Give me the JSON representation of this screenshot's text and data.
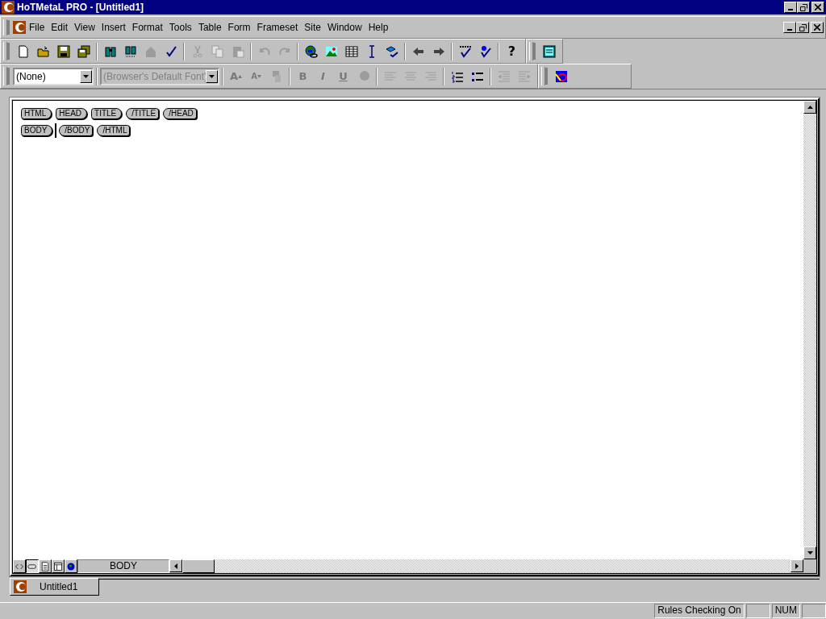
{
  "window": {
    "title": "HoTMetaL PRO - [Untitled1]"
  },
  "menu": [
    "File",
    "Edit",
    "View",
    "Insert",
    "Format",
    "Tools",
    "Table",
    "Form",
    "Frameset",
    "Site",
    "Window",
    "Help"
  ],
  "toolbar": [
    {
      "kind": "new",
      "disabled": false
    },
    {
      "kind": "open",
      "disabled": false
    },
    {
      "kind": "save",
      "disabled": false
    },
    {
      "kind": "saveall",
      "disabled": false
    },
    {
      "kind": "sep"
    },
    {
      "kind": "find",
      "disabled": false
    },
    {
      "kind": "findnext",
      "disabled": false
    },
    {
      "kind": "replace",
      "disabled": true
    },
    {
      "kind": "spell",
      "disabled": false
    },
    {
      "kind": "sep"
    },
    {
      "kind": "cut",
      "disabled": true
    },
    {
      "kind": "copy",
      "disabled": true
    },
    {
      "kind": "paste",
      "disabled": true
    },
    {
      "kind": "sep"
    },
    {
      "kind": "undo",
      "disabled": true
    },
    {
      "kind": "redo",
      "disabled": true
    },
    {
      "kind": "sep"
    },
    {
      "kind": "link",
      "disabled": false
    },
    {
      "kind": "image",
      "disabled": false
    },
    {
      "kind": "table",
      "disabled": false
    },
    {
      "kind": "cursor",
      "disabled": false
    },
    {
      "kind": "highlight",
      "disabled": false
    },
    {
      "kind": "sep"
    },
    {
      "kind": "back",
      "disabled": false
    },
    {
      "kind": "forward",
      "disabled": false
    },
    {
      "kind": "sep"
    },
    {
      "kind": "validate",
      "disabled": false
    },
    {
      "kind": "check",
      "disabled": false
    },
    {
      "kind": "sep"
    },
    {
      "kind": "help",
      "label": "?",
      "disabled": false
    }
  ],
  "toolbar_extra": [
    {
      "kind": "panel",
      "disabled": false
    }
  ],
  "format_bar": {
    "style": {
      "value": "(None)",
      "disabled": false
    },
    "font": {
      "value": "(Browser's Default Font)",
      "disabled": true
    },
    "buttons": [
      {
        "kind": "bigger",
        "label": "A",
        "disabled": true
      },
      {
        "kind": "smaller",
        "label": "A",
        "disabled": true
      },
      {
        "kind": "paint",
        "disabled": true
      },
      {
        "kind": "sep"
      },
      {
        "kind": "bold",
        "label": "B",
        "disabled": true
      },
      {
        "kind": "italic",
        "label": "I",
        "disabled": true
      },
      {
        "kind": "underline",
        "label": "U",
        "disabled": true
      },
      {
        "kind": "color",
        "disabled": true
      },
      {
        "kind": "sep"
      },
      {
        "kind": "left",
        "disabled": true
      },
      {
        "kind": "center",
        "disabled": true
      },
      {
        "kind": "right",
        "disabled": true
      },
      {
        "kind": "sep"
      },
      {
        "kind": "ol",
        "disabled": false
      },
      {
        "kind": "ul",
        "disabled": false
      },
      {
        "kind": "sep"
      },
      {
        "kind": "outdent",
        "disabled": true
      },
      {
        "kind": "indent",
        "disabled": true
      }
    ],
    "extra": [
      {
        "kind": "special",
        "disabled": false
      }
    ]
  },
  "document": {
    "tag_rows": [
      [
        {
          "label": "HTML",
          "kind": "open"
        },
        {
          "label": "HEAD",
          "kind": "open"
        },
        {
          "label": "TITLE",
          "kind": "open"
        },
        {
          "label": "/TITLE",
          "kind": "close"
        },
        {
          "label": "/HEAD",
          "kind": "close"
        }
      ],
      [
        {
          "label": "BODY",
          "kind": "open",
          "cursor_after": true
        },
        {
          "label": "/BODY",
          "kind": "close"
        },
        {
          "label": "/HTML",
          "kind": "close"
        }
      ]
    ],
    "view_tabs": [
      {
        "kind": "source",
        "selected": false
      },
      {
        "kind": "tags",
        "selected": true
      },
      {
        "kind": "page",
        "selected": false
      },
      {
        "kind": "layout",
        "selected": false
      },
      {
        "kind": "browser",
        "selected": false
      }
    ],
    "element_path": "BODY"
  },
  "doc_tabs": [
    {
      "label": "Untitled1",
      "selected": true
    }
  ],
  "status_bar": [
    "Rules Checking On",
    "NUM"
  ]
}
